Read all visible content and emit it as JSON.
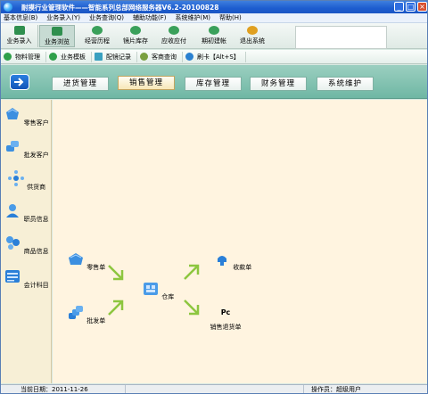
{
  "window": {
    "title": "耐摸行业管理软件——智能系列总部网络服务器V6.2-20100828",
    "buttons": {
      "minimize": "_",
      "maximize": "□",
      "close": "×"
    }
  },
  "menubar": [
    "基本信息(B)",
    "业务录入(Y)",
    "业务查询(Q)",
    "辅助功能(F)",
    "系统维护(M)",
    "帮助(H)"
  ],
  "toolbar_main": [
    {
      "label": "业务录入",
      "icon": "entry-icon",
      "color": "#2f8f4e"
    },
    {
      "label": "业务浏览",
      "icon": "browse-icon",
      "color": "#2f8f4e"
    },
    {
      "label": "经营历程",
      "icon": "history-icon",
      "color": "#3aa05a"
    },
    {
      "label": "镜片库存",
      "icon": "lens-stock-icon",
      "color": "#3aa05a"
    },
    {
      "label": "应收应付",
      "icon": "receivable-icon",
      "color": "#3aa05a"
    },
    {
      "label": "期初建帐",
      "icon": "opening-ledger-icon",
      "color": "#3aa05a"
    },
    {
      "label": "退出系统",
      "icon": "exit-icon",
      "color": "#e0a020"
    }
  ],
  "toolbar_secondary": [
    {
      "label": "物料管理",
      "icon": "material-icon",
      "color": "#2fa04a"
    },
    {
      "label": "业务模板",
      "icon": "template-icon",
      "color": "#2fa04a"
    },
    {
      "label": "配镜记录",
      "icon": "record-icon",
      "color": "#3aa0c0"
    },
    {
      "label": "客商查询",
      "icon": "query-icon",
      "color": "#7aa040"
    },
    {
      "label": "刷卡【Alt+S】",
      "icon": "card-icon",
      "color": "#2a80d0"
    }
  ],
  "tabs": [
    {
      "label": "进货管理",
      "active": false
    },
    {
      "label": "销售管理",
      "active": true
    },
    {
      "label": "库存管理",
      "active": false
    },
    {
      "label": "财务管理",
      "active": false
    },
    {
      "label": "系统维护",
      "active": false
    }
  ],
  "sidebar": [
    {
      "label": "零售客户",
      "icon": "retail-customer-icon"
    },
    {
      "label": "批发客户",
      "icon": "wholesale-customer-icon"
    },
    {
      "label": "供货商",
      "icon": "supplier-icon"
    },
    {
      "label": "职员信息",
      "icon": "staff-icon"
    },
    {
      "label": "商品信息",
      "icon": "product-icon"
    },
    {
      "label": "会计科目",
      "icon": "account-subject-icon"
    }
  ],
  "flow": {
    "retail_order": "零售单",
    "wholesale_order": "批发单",
    "warehouse": "仓库",
    "receipt": "收款单",
    "sales_return": "销售退货单",
    "sales_return_icon_text": "Pc"
  },
  "colors": {
    "accent": "#2b7fe0",
    "arrow": "#8dc63f",
    "content_bg": "#fff4e0",
    "sidebar_bg": "#f7efd6"
  },
  "statusbar": {
    "date_label": "当前日期：",
    "date": "2011-11-26",
    "operator_label": "操作员：",
    "operator": "超级用户"
  }
}
